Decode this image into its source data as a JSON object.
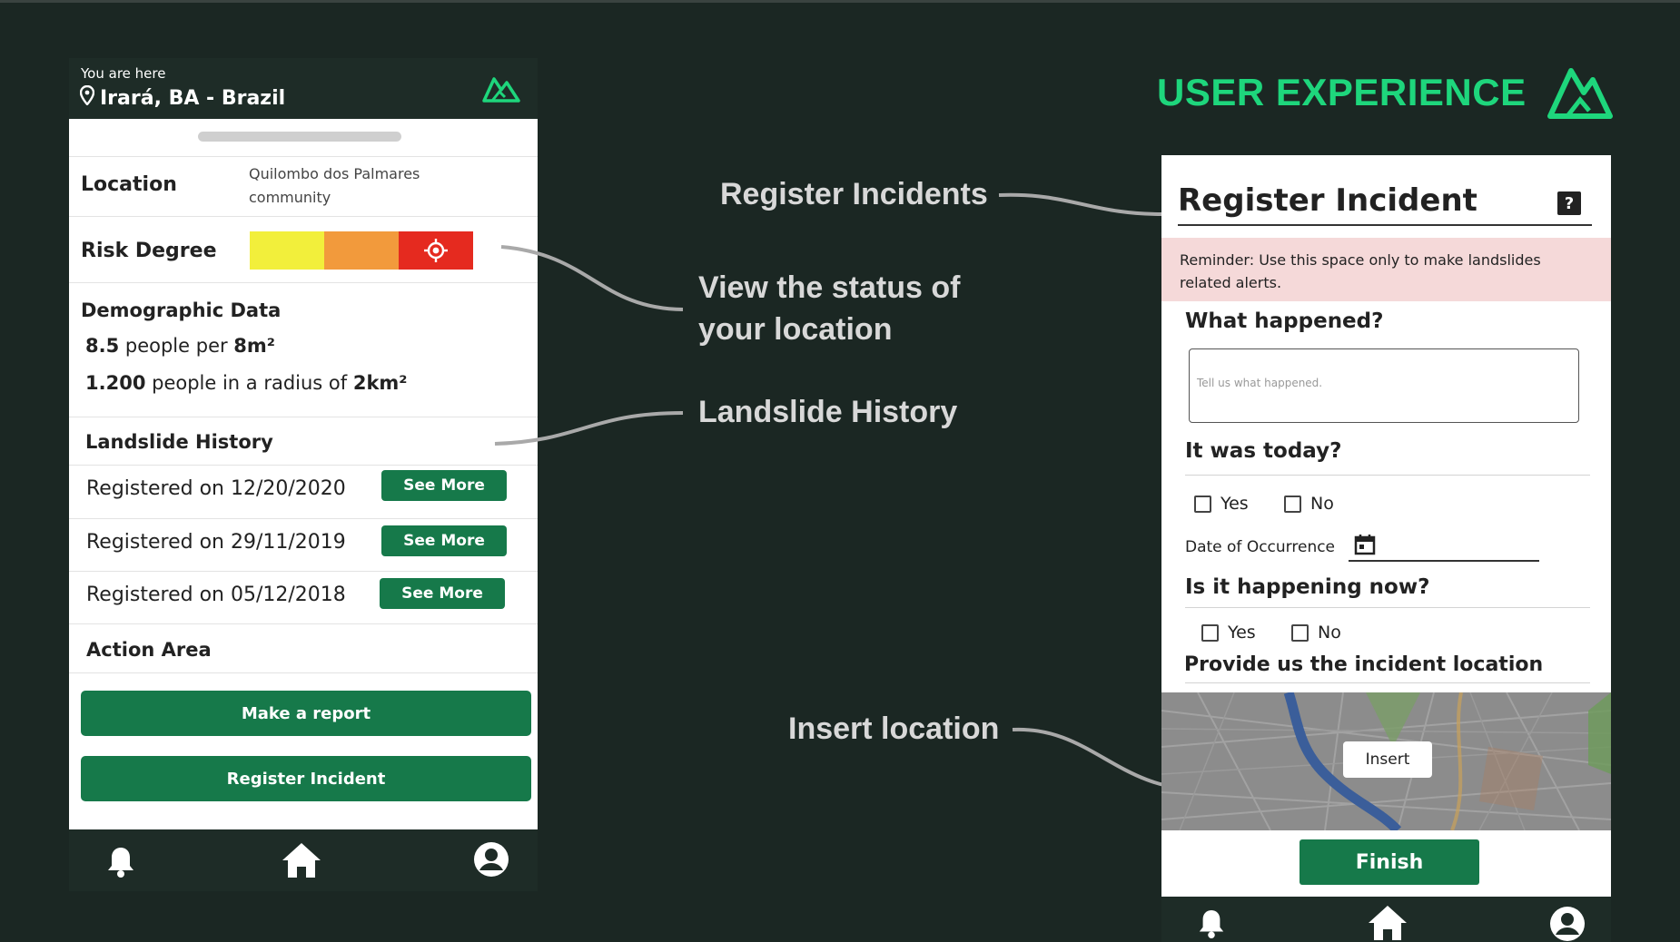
{
  "left_phone": {
    "header": {
      "here_label": "You are here",
      "location": "Irará, BA - Brazil"
    },
    "location_label": "Location",
    "location_value_line1": "Quilombo dos Palmares",
    "location_value_line2": "community",
    "risk_label": "Risk Degree",
    "risk_colors": [
      "#f2ef3b",
      "#f29a3c",
      "#e52a1f"
    ],
    "demographic": {
      "heading": "Demographic Data",
      "line1_num": "8.5",
      "line1_mid": " people per ",
      "line1_unit": "8m²",
      "line2_num": "1.200",
      "line2_mid": " people in a radius of ",
      "line2_unit": "2km²"
    },
    "history": {
      "heading": "Landslide History",
      "rows": [
        {
          "text": "Registered on 12/20/2020",
          "button": "See More"
        },
        {
          "text": "Registered on 29/11/2019",
          "button": "See More"
        },
        {
          "text": "Registered on 05/12/2018",
          "button": "See More"
        }
      ]
    },
    "action_area": "Action Area",
    "make_report": "Make a report",
    "register_incident": "Register Incident"
  },
  "title": "USER EXPERIENCE",
  "callouts": {
    "register": "Register Incidents",
    "status_line1": "View the status of",
    "status_line2": "your location",
    "history": "Landslide History",
    "insert": "Insert location"
  },
  "right_phone": {
    "title": "Register Incident",
    "help": "?",
    "reminder": "Reminder: Use this space only to make landslides related alerts.",
    "q1": "What happened?",
    "q1_placeholder": "Tell us what happened.",
    "q2": "It was today?",
    "yes": "Yes",
    "no": "No",
    "date_label": "Date of Occurrence",
    "q3": "Is it happening now?",
    "q4": "Provide us the incident location",
    "insert": "Insert",
    "finish": "Finish"
  },
  "colors": {
    "accent": "#1ed67c",
    "button": "#16794a",
    "background": "#1b2723",
    "nav": "#1e2c27"
  }
}
